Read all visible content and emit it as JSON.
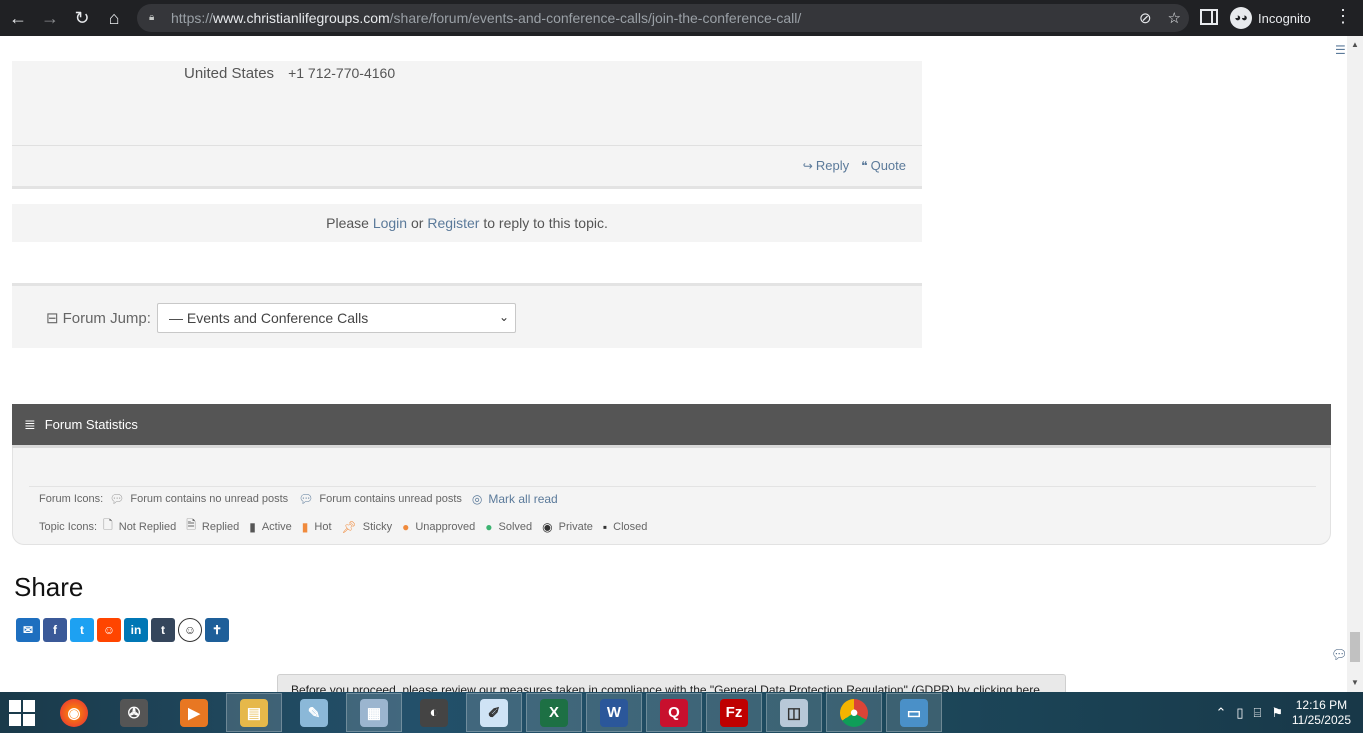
{
  "browser": {
    "url_prefix": "https://",
    "url_host": "www.christianlifegroups.com",
    "url_path": "/share/forum/events-and-conference-calls/join-the-conference-call/",
    "profile_label": "Incognito"
  },
  "post": {
    "country": "United States",
    "phone": "+1 712-770-4160",
    "reply_label": "Reply",
    "quote_label": "Quote"
  },
  "login_prompt": {
    "prefix": "Please",
    "login_link": "Login",
    "or_text": "or",
    "register_link": "Register",
    "suffix": "to reply to this topic."
  },
  "forum_jump": {
    "label": "Forum Jump:",
    "selected": "— Events and Conference Calls"
  },
  "stats": {
    "title": "Forum Statistics",
    "forum_icons_label": "Forum Icons:",
    "no_unread": "Forum contains no unread posts",
    "unread": "Forum contains unread posts",
    "mark_all_read": "Mark all read",
    "topic_icons_label": "Topic Icons:",
    "topic_icons": [
      "Not Replied",
      "Replied",
      "Active",
      "Hot",
      "Sticky",
      "Unapproved",
      "Solved",
      "Private",
      "Closed"
    ]
  },
  "share": {
    "title": "Share"
  },
  "gdpr": {
    "text": "Before you proceed, please review our measures taken in compliance with the \"General Data Protection Regulation\" (GDPR) by clicking here ..."
  },
  "taskbar": {
    "time": "12:16 PM",
    "date": "11/25/2025"
  },
  "colors": {
    "link": "#5b7a9a",
    "stats_header": "#555555",
    "panel": "#f4f4f4",
    "chrome": "#202124"
  }
}
